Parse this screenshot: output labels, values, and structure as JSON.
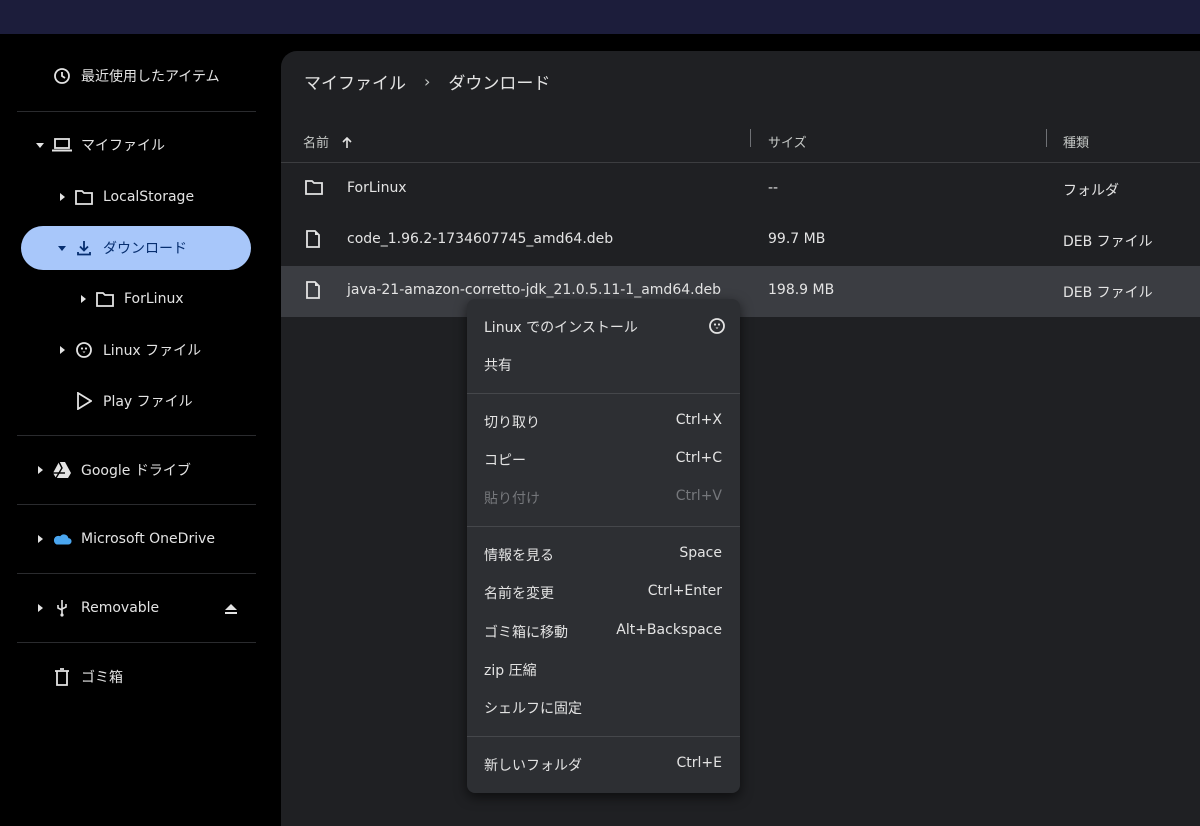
{
  "sidebar": {
    "recent": "最近使用したアイテム",
    "my_files": "マイファイル",
    "local_storage": "LocalStorage",
    "downloads": "ダウンロード",
    "forlinux": "ForLinux",
    "linux_files": "Linux ファイル",
    "play_files": "Play ファイル",
    "google_drive": "Google ドライブ",
    "onedrive": "Microsoft OneDrive",
    "removable": "Removable",
    "trash": "ゴミ箱"
  },
  "breadcrumb": {
    "root": "マイファイル",
    "current": "ダウンロード"
  },
  "table": {
    "headers": {
      "name": "名前",
      "size": "サイズ",
      "type": "種類"
    },
    "rows": [
      {
        "name": "ForLinux",
        "size": "--",
        "type": "フォルダ",
        "icon": "folder-icon"
      },
      {
        "name": "code_1.96.2-1734607745_amd64.deb",
        "size": "99.7 MB",
        "type": "DEB ファイル",
        "icon": "file-icon"
      },
      {
        "name": "java-21-amazon-corretto-jdk_21.0.5.11-1_amd64.deb",
        "size": "198.9 MB",
        "type": "DEB ファイル",
        "icon": "file-icon"
      }
    ]
  },
  "context_menu": {
    "items": [
      {
        "label": "Linux でのインストール",
        "shortcut": ""
      },
      {
        "label": "共有",
        "shortcut": ""
      },
      {
        "label": "切り取り",
        "shortcut": "Ctrl+X"
      },
      {
        "label": "コピー",
        "shortcut": "Ctrl+C"
      },
      {
        "label": "貼り付け",
        "shortcut": "Ctrl+V"
      },
      {
        "label": "情報を見る",
        "shortcut": "Space"
      },
      {
        "label": "名前を変更",
        "shortcut": "Ctrl+Enter"
      },
      {
        "label": "ゴミ箱に移動",
        "shortcut": "Alt+Backspace"
      },
      {
        "label": "zip 圧縮",
        "shortcut": ""
      },
      {
        "label": "シェルフに固定",
        "shortcut": ""
      },
      {
        "label": "新しいフォルダ",
        "shortcut": "Ctrl+E"
      }
    ]
  },
  "colors": {
    "accent": "#a8c7fa",
    "panel": "#1f2023",
    "menu": "#2d2f33",
    "selected_row": "#3b3d42"
  }
}
